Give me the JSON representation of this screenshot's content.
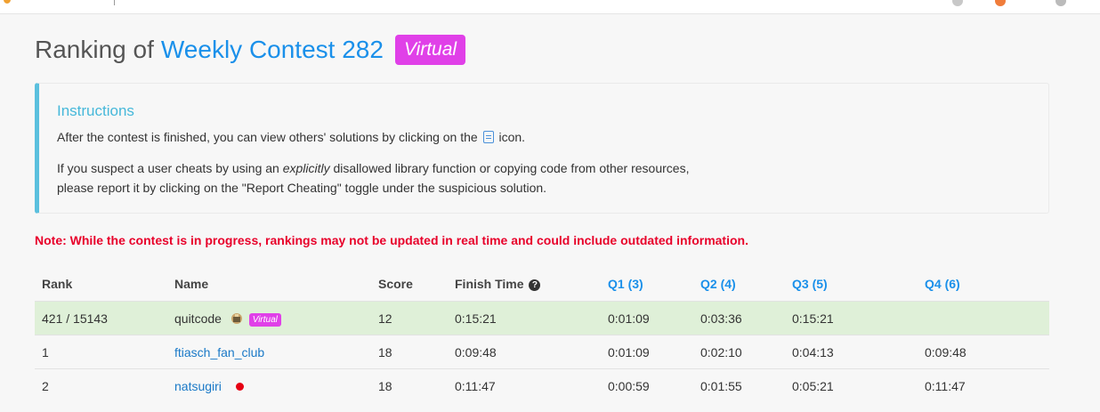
{
  "page": {
    "title_prefix": "Ranking of",
    "contest_name": "Weekly Contest 282",
    "virtual_badge": "Virtual"
  },
  "instructions": {
    "heading": "Instructions",
    "p1_before_icon": "After the contest is finished, you can view others' solutions by clicking on the",
    "p1_after_icon": "icon.",
    "p2_before_em": "If you suspect a user cheats by using an",
    "p2_em": "explicitly",
    "p2_after_em": "disallowed library function or copying code from other resources,",
    "p2_line2": "please report it by clicking on the \"Report Cheating\" toggle under the suspicious solution."
  },
  "note": "Note: While the contest is in progress, rankings may not be updated in real time and could include outdated information.",
  "table": {
    "headers": {
      "rank": "Rank",
      "name": "Name",
      "score": "Score",
      "finish_time": "Finish Time",
      "q1": "Q1 (3)",
      "q2": "Q2 (4)",
      "q3": "Q3 (5)",
      "q4": "Q4 (6)"
    },
    "rows": [
      {
        "rank": "421 / 15143",
        "name": "quitcode",
        "badge": "Virtual",
        "score": "12",
        "finish_time": "0:15:21",
        "q1": "0:01:09",
        "q2": "0:03:36",
        "q3": "0:15:21",
        "q4": ""
      },
      {
        "rank": "1",
        "name": "ftiasch_fan_club",
        "score": "18",
        "finish_time": "0:09:48",
        "q1": "0:01:09",
        "q2": "0:02:10",
        "q3": "0:04:13",
        "q4": "0:09:48"
      },
      {
        "rank": "2",
        "name": "natsugiri",
        "score": "18",
        "finish_time": "0:11:47",
        "q1": "0:00:59",
        "q2": "0:01:55",
        "q3": "0:05:21",
        "q4": "0:11:47"
      }
    ]
  },
  "icons": {
    "help": "question-circle-icon",
    "solution": "code-file-icon",
    "avatar": "avatar-icon",
    "country": "japan-flag-icon"
  },
  "colors": {
    "accent": "#1a90ea",
    "virtual_badge": "#e040e8",
    "note_red": "#e8002a",
    "info_border": "#5bc0de",
    "my_row": "#dff0d8"
  }
}
